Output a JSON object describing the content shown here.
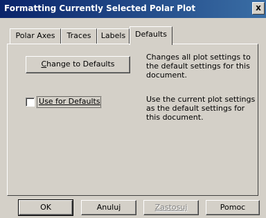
{
  "window": {
    "title": "Formatting Currently Selected Polar Plot",
    "close_glyph": "x"
  },
  "tabs": [
    {
      "label": "Polar Axes",
      "active": false
    },
    {
      "label": "Traces",
      "active": false
    },
    {
      "label": "Labels",
      "active": false
    },
    {
      "label": "Defaults",
      "active": true
    }
  ],
  "defaults_panel": {
    "change_button": {
      "accel": "C",
      "rest": "hange to Defaults"
    },
    "change_description": "Changes all plot settings to the default settings for this document.",
    "use_checkbox": {
      "accel": "U",
      "rest": "se for Defaults",
      "checked": false
    },
    "use_description": "Use the current plot settings as the default settings for this document."
  },
  "footer": {
    "ok_label": "OK",
    "cancel_label": "Anuluj",
    "apply_label": "Zastosuj",
    "help_label": "Pomoc"
  }
}
